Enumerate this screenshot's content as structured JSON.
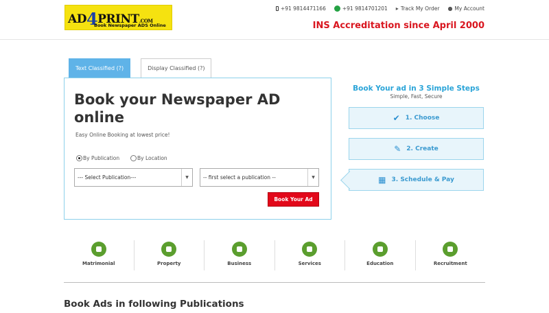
{
  "header": {
    "logo": {
      "ad": "AD",
      "four": "4",
      "print": "PRINT",
      "dotcom": ".COM",
      "tagline": "Book Newspaper ADS Online"
    },
    "phone1": "+91 9814471166",
    "phone2": "+91 9814701201",
    "track_order": "Track My Order",
    "my_account": "My Account",
    "accreditation": "INS Accreditation since April 2000"
  },
  "tabs": [
    {
      "label": "Text Classified (?)",
      "active": true
    },
    {
      "label": "Display Classified (?)",
      "active": false
    }
  ],
  "form": {
    "title": "Book your Newspaper AD online",
    "subtitle": "Easy Online Booking at lowest price!",
    "radio_publication": "By Publication",
    "radio_location": "By Location",
    "selected_radio": "By Publication",
    "select_publication": "--- Select Publication---",
    "select_second": "-- first select a publication --",
    "book_button": "Book Your Ad"
  },
  "steps": {
    "title": "Book Your ad in 3 Simple Steps",
    "subtitle": "Simple, Fast, Secure",
    "items": [
      {
        "label": "1. Choose",
        "icon": "check-icon"
      },
      {
        "label": "2. Create",
        "icon": "edit-icon"
      },
      {
        "label": "3. Schedule & Pay",
        "icon": "calendar-icon"
      }
    ]
  },
  "categories": [
    {
      "label": "Matrimonial",
      "icon": "matrimonial-icon"
    },
    {
      "label": "Property",
      "icon": "property-icon"
    },
    {
      "label": "Business",
      "icon": "business-icon"
    },
    {
      "label": "Services",
      "icon": "services-icon"
    },
    {
      "label": "Education",
      "icon": "education-icon"
    },
    {
      "label": "Recruitment",
      "icon": "recruitment-icon"
    }
  ],
  "publications_heading": "Book Ads in following Publications",
  "colors": {
    "accent": "#2aa4d8",
    "tab_active": "#5fb3e8",
    "brand_red": "#d9161f",
    "logo_yellow": "#f5e210",
    "category_green": "#5b9e2e"
  }
}
